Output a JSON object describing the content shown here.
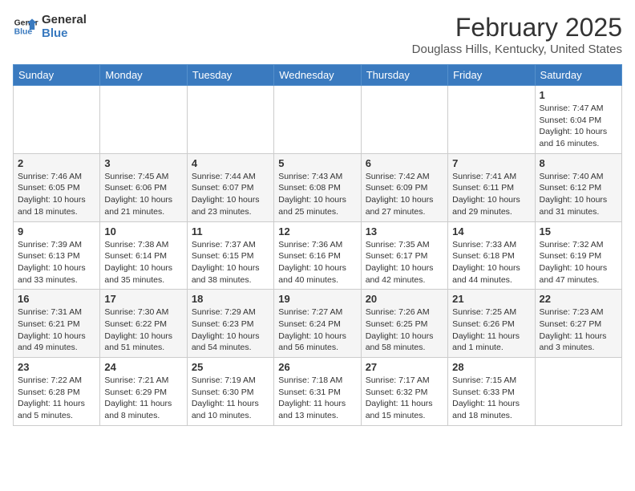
{
  "header": {
    "logo_line1": "General",
    "logo_line2": "Blue",
    "month": "February 2025",
    "location": "Douglass Hills, Kentucky, United States"
  },
  "weekdays": [
    "Sunday",
    "Monday",
    "Tuesday",
    "Wednesday",
    "Thursday",
    "Friday",
    "Saturday"
  ],
  "weeks": [
    [
      {
        "day": "",
        "info": ""
      },
      {
        "day": "",
        "info": ""
      },
      {
        "day": "",
        "info": ""
      },
      {
        "day": "",
        "info": ""
      },
      {
        "day": "",
        "info": ""
      },
      {
        "day": "",
        "info": ""
      },
      {
        "day": "1",
        "info": "Sunrise: 7:47 AM\nSunset: 6:04 PM\nDaylight: 10 hours\nand 16 minutes."
      }
    ],
    [
      {
        "day": "2",
        "info": "Sunrise: 7:46 AM\nSunset: 6:05 PM\nDaylight: 10 hours\nand 18 minutes."
      },
      {
        "day": "3",
        "info": "Sunrise: 7:45 AM\nSunset: 6:06 PM\nDaylight: 10 hours\nand 21 minutes."
      },
      {
        "day": "4",
        "info": "Sunrise: 7:44 AM\nSunset: 6:07 PM\nDaylight: 10 hours\nand 23 minutes."
      },
      {
        "day": "5",
        "info": "Sunrise: 7:43 AM\nSunset: 6:08 PM\nDaylight: 10 hours\nand 25 minutes."
      },
      {
        "day": "6",
        "info": "Sunrise: 7:42 AM\nSunset: 6:09 PM\nDaylight: 10 hours\nand 27 minutes."
      },
      {
        "day": "7",
        "info": "Sunrise: 7:41 AM\nSunset: 6:11 PM\nDaylight: 10 hours\nand 29 minutes."
      },
      {
        "day": "8",
        "info": "Sunrise: 7:40 AM\nSunset: 6:12 PM\nDaylight: 10 hours\nand 31 minutes."
      }
    ],
    [
      {
        "day": "9",
        "info": "Sunrise: 7:39 AM\nSunset: 6:13 PM\nDaylight: 10 hours\nand 33 minutes."
      },
      {
        "day": "10",
        "info": "Sunrise: 7:38 AM\nSunset: 6:14 PM\nDaylight: 10 hours\nand 35 minutes."
      },
      {
        "day": "11",
        "info": "Sunrise: 7:37 AM\nSunset: 6:15 PM\nDaylight: 10 hours\nand 38 minutes."
      },
      {
        "day": "12",
        "info": "Sunrise: 7:36 AM\nSunset: 6:16 PM\nDaylight: 10 hours\nand 40 minutes."
      },
      {
        "day": "13",
        "info": "Sunrise: 7:35 AM\nSunset: 6:17 PM\nDaylight: 10 hours\nand 42 minutes."
      },
      {
        "day": "14",
        "info": "Sunrise: 7:33 AM\nSunset: 6:18 PM\nDaylight: 10 hours\nand 44 minutes."
      },
      {
        "day": "15",
        "info": "Sunrise: 7:32 AM\nSunset: 6:19 PM\nDaylight: 10 hours\nand 47 minutes."
      }
    ],
    [
      {
        "day": "16",
        "info": "Sunrise: 7:31 AM\nSunset: 6:21 PM\nDaylight: 10 hours\nand 49 minutes."
      },
      {
        "day": "17",
        "info": "Sunrise: 7:30 AM\nSunset: 6:22 PM\nDaylight: 10 hours\nand 51 minutes."
      },
      {
        "day": "18",
        "info": "Sunrise: 7:29 AM\nSunset: 6:23 PM\nDaylight: 10 hours\nand 54 minutes."
      },
      {
        "day": "19",
        "info": "Sunrise: 7:27 AM\nSunset: 6:24 PM\nDaylight: 10 hours\nand 56 minutes."
      },
      {
        "day": "20",
        "info": "Sunrise: 7:26 AM\nSunset: 6:25 PM\nDaylight: 10 hours\nand 58 minutes."
      },
      {
        "day": "21",
        "info": "Sunrise: 7:25 AM\nSunset: 6:26 PM\nDaylight: 11 hours\nand 1 minute."
      },
      {
        "day": "22",
        "info": "Sunrise: 7:23 AM\nSunset: 6:27 PM\nDaylight: 11 hours\nand 3 minutes."
      }
    ],
    [
      {
        "day": "23",
        "info": "Sunrise: 7:22 AM\nSunset: 6:28 PM\nDaylight: 11 hours\nand 5 minutes."
      },
      {
        "day": "24",
        "info": "Sunrise: 7:21 AM\nSunset: 6:29 PM\nDaylight: 11 hours\nand 8 minutes."
      },
      {
        "day": "25",
        "info": "Sunrise: 7:19 AM\nSunset: 6:30 PM\nDaylight: 11 hours\nand 10 minutes."
      },
      {
        "day": "26",
        "info": "Sunrise: 7:18 AM\nSunset: 6:31 PM\nDaylight: 11 hours\nand 13 minutes."
      },
      {
        "day": "27",
        "info": "Sunrise: 7:17 AM\nSunset: 6:32 PM\nDaylight: 11 hours\nand 15 minutes."
      },
      {
        "day": "28",
        "info": "Sunrise: 7:15 AM\nSunset: 6:33 PM\nDaylight: 11 hours\nand 18 minutes."
      },
      {
        "day": "",
        "info": ""
      }
    ]
  ]
}
